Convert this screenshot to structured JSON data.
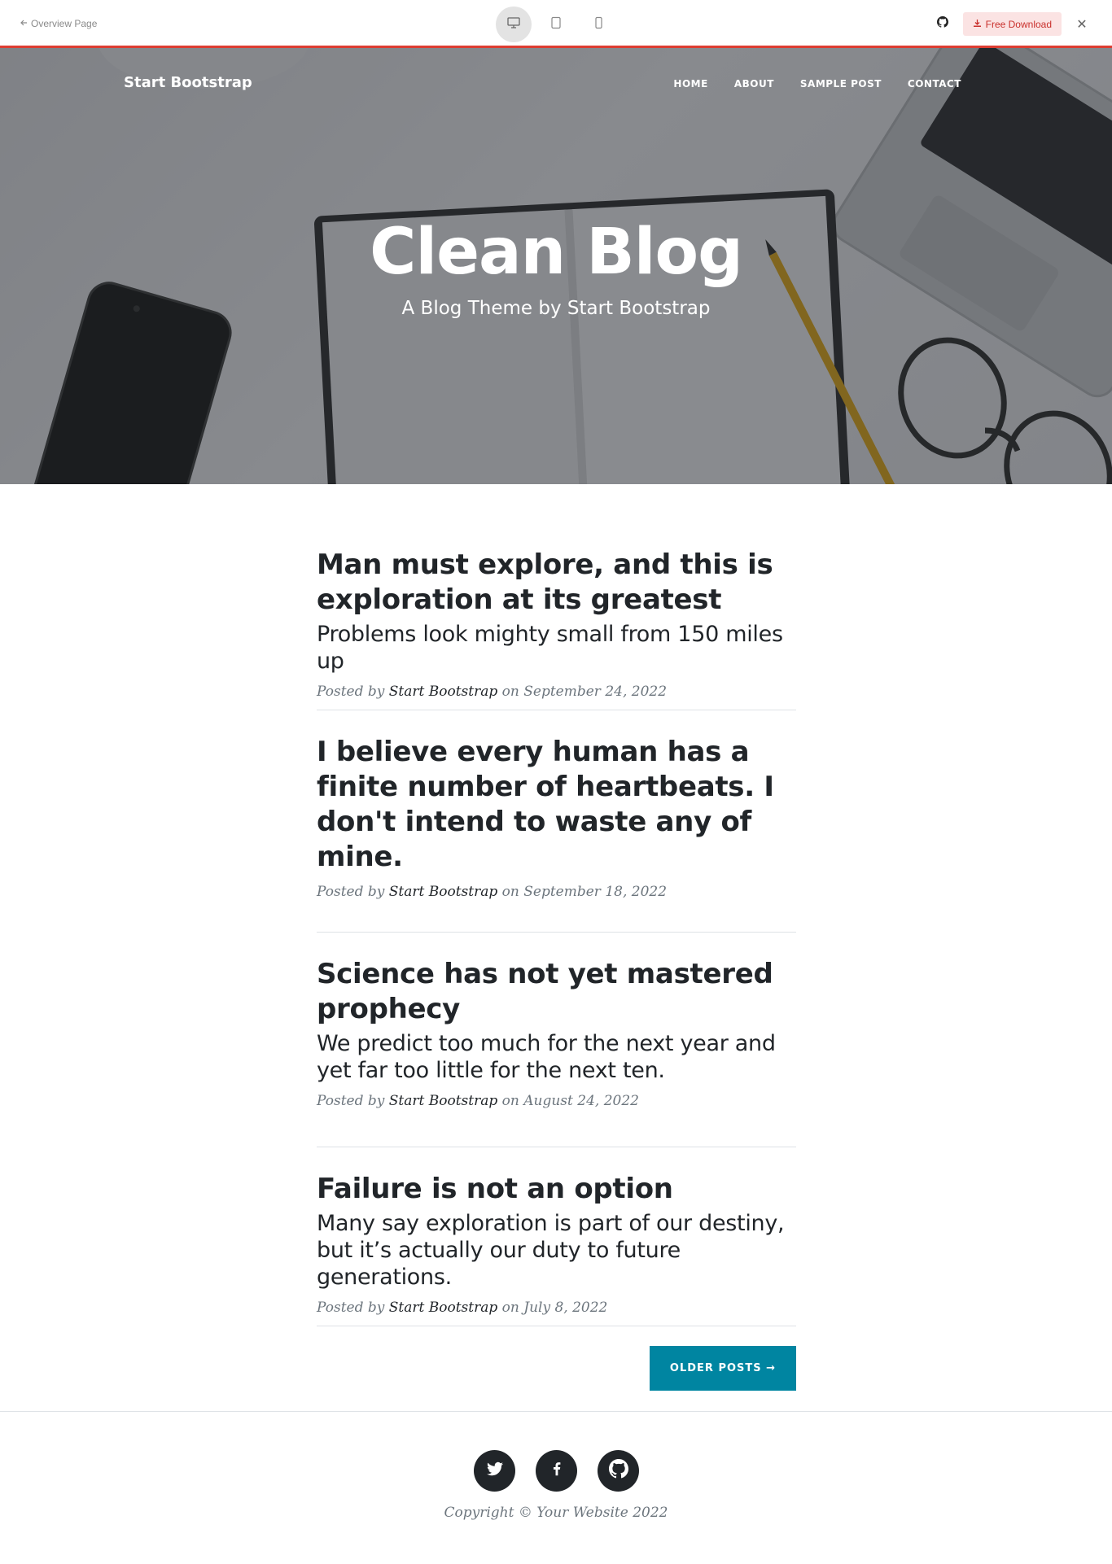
{
  "preview_bar": {
    "back_label": "Overview Page",
    "download_label": "Free Download",
    "devices": [
      "desktop-icon",
      "tablet-icon",
      "phone-icon"
    ],
    "active_device": "desktop",
    "accent_color": "#dd3d31"
  },
  "site": {
    "brand": "Start Bootstrap",
    "nav": [
      "HOME",
      "ABOUT",
      "SAMPLE POST",
      "CONTACT"
    ],
    "hero_title": "Clean Blog",
    "hero_subtitle": "A Blog Theme by Start Bootstrap"
  },
  "posts": [
    {
      "title": "Man must explore, and this is exploration at its greatest",
      "subtitle": "Problems look mighty small from 150 miles up",
      "posted_by": "Posted by",
      "author": "Start Bootstrap",
      "on": "on",
      "date": "September 24, 2022"
    },
    {
      "title": "I believe every human has a finite number of heartbeats. I don't intend to waste any of mine.",
      "subtitle": "",
      "posted_by": "Posted by",
      "author": "Start Bootstrap",
      "on": "on",
      "date": "September 18, 2022"
    },
    {
      "title": "Science has not yet mastered prophecy",
      "subtitle": "We predict too much for the next year and yet far too little for the next ten.",
      "posted_by": "Posted by",
      "author": "Start Bootstrap",
      "on": "on",
      "date": "August 24, 2022"
    },
    {
      "title": "Failure is not an option",
      "subtitle": "Many say exploration is part of our destiny, but it’s actually our duty to future generations.",
      "posted_by": "Posted by",
      "author": "Start Bootstrap",
      "on": "on",
      "date": "July 8, 2022"
    }
  ],
  "pager": {
    "older_label": "OLDER POSTS →",
    "button_color": "#0085a1"
  },
  "footer": {
    "socials": [
      "twitter-icon",
      "facebook-icon",
      "github-icon"
    ],
    "copyright": "Copyright © Your Website 2022"
  }
}
